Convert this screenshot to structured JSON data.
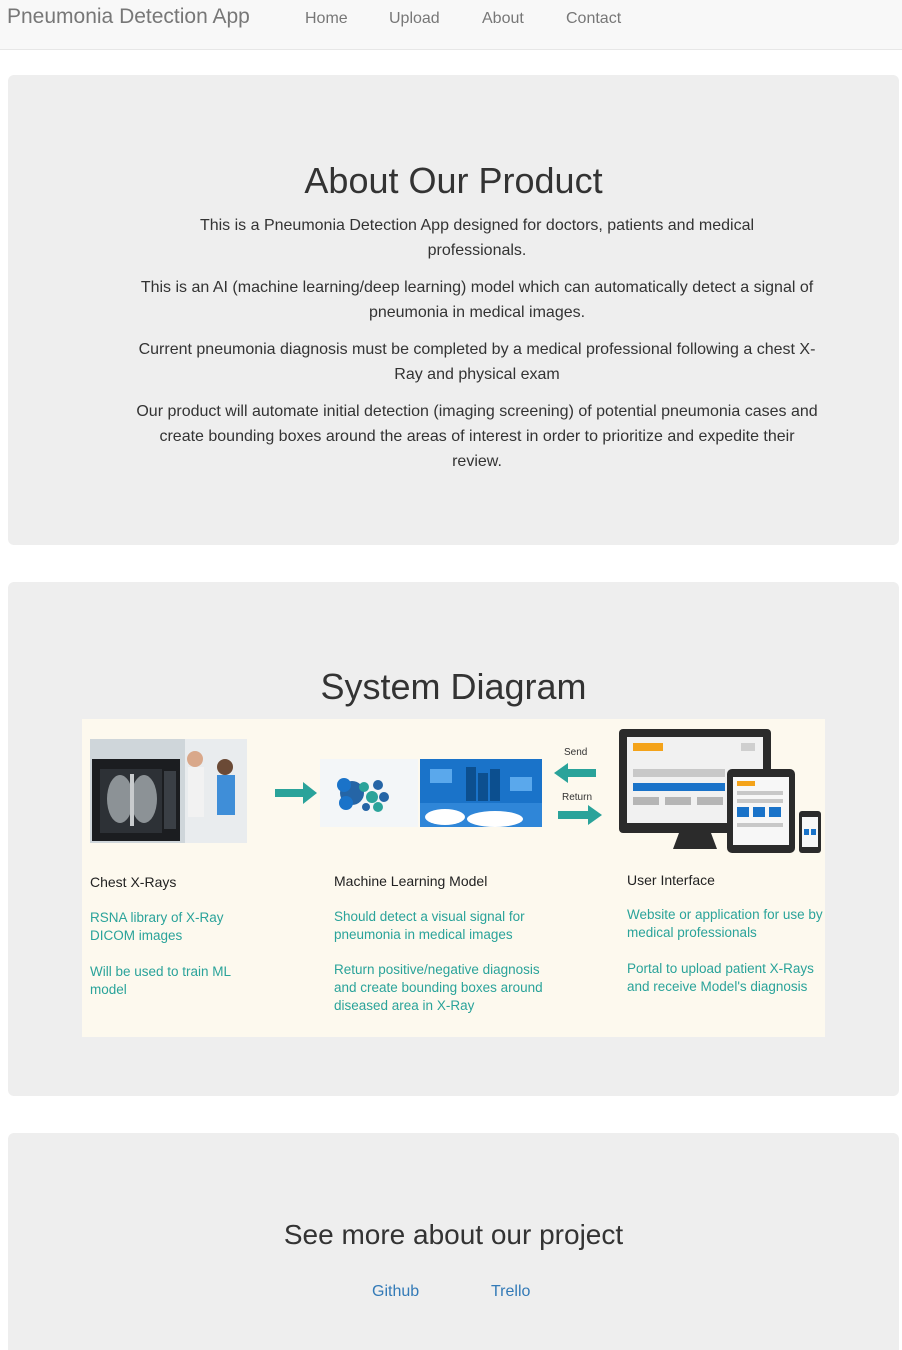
{
  "navbar": {
    "brand": "Pneumonia Detection App",
    "items": [
      {
        "label": "Home"
      },
      {
        "label": "Upload"
      },
      {
        "label": "About"
      },
      {
        "label": "Contact"
      }
    ]
  },
  "about": {
    "title": "About Our Product",
    "paragraphs": [
      "This is a Pneumonia Detection App designed for doctors, patients and medical professionals.",
      "This is an AI (machine learning/deep learning) model which can automatically detect a signal of pneumonia in medical images.",
      "Current pneumonia diagnosis must be completed by a medical professional following a chest X-Ray and physical exam",
      "Our product will automate initial detection (imaging screening) of potential pneumonia cases and create bounding boxes around the areas of interest in order to prioritize and expedite their review."
    ]
  },
  "diagram": {
    "title": "System Diagram",
    "send_label": "Send",
    "return_label": "Return",
    "columns": [
      {
        "heading": "Chest X-Rays",
        "notes": [
          "RSNA library of X-Ray DICOM images",
          "Will be used to train ML model"
        ]
      },
      {
        "heading": "Machine Learning Model",
        "notes": [
          "Should detect a visual signal for pneumonia in medical images",
          "Return positive/negative diagnosis and create bounding boxes around diseased area in X-Ray"
        ]
      },
      {
        "heading": "User Interface",
        "notes": [
          "Website or application for use by medical professionals",
          "Portal to upload patient X-Rays and receive Model's diagnosis"
        ]
      }
    ],
    "colors": {
      "teal": "#2aa39a",
      "blue": "#1a73c9",
      "dark": "#333333",
      "orange": "#f4a31a"
    }
  },
  "project": {
    "title": "See more about our project",
    "links": [
      {
        "label": "Github"
      },
      {
        "label": "Trello"
      }
    ]
  }
}
